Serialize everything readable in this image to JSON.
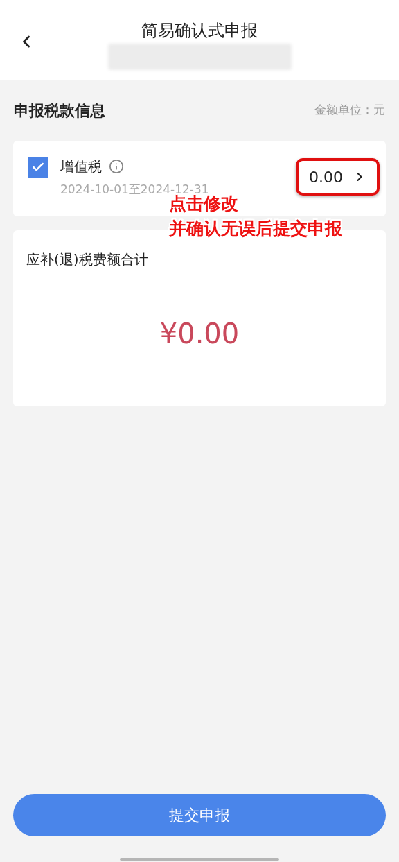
{
  "header": {
    "title": "简易确认式申报"
  },
  "section": {
    "title": "申报税款信息",
    "unit_note": "金额单位：元"
  },
  "tax_items": [
    {
      "name": "增值税",
      "period": "2024-10-01至2024-12-31",
      "amount": "0.00",
      "checked": true,
      "highlighted": true
    }
  ],
  "total": {
    "label": "应补(退)税费额合计",
    "amount": "¥0.00"
  },
  "annotation": {
    "lines": [
      "点击修改",
      "并确认无误后提交申报"
    ]
  },
  "submit_button": "提交申报"
}
